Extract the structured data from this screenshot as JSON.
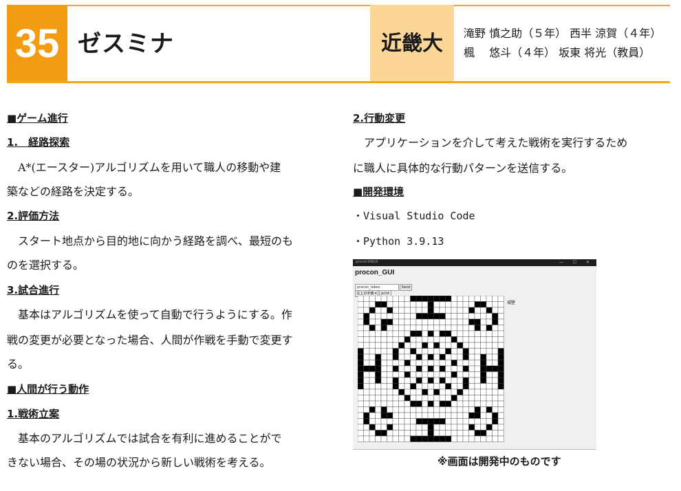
{
  "header": {
    "number": "35",
    "team_name": "ゼスミナ",
    "school": "近畿大",
    "members_line1": "滝野 慎之助（５年） 西半 涼賀（４年）",
    "members_line2": "楓　 悠斗（４年） 坂東 将光（教員）",
    "accent_color": "#f39c12",
    "school_bg": "#fcd697"
  },
  "left": {
    "game_heading": "■ゲーム進行",
    "s1_heading": "1.　経路探索",
    "s1_line1": "　A*(エースター)アルゴリズムを用いて職人の移動や建",
    "s1_line2": "築などの経路を決定する。",
    "s2_heading": "2.評価方法",
    "s2_line1": "　スタート地点から目的地に向かう経路を調べ、最短のも",
    "s2_line2": "のを選択する。",
    "s3_heading": "3.試合進行",
    "s3_line1": "　基本はアルゴリズムを使って自動で行うようにする。作",
    "s3_line2": "戦の変更が必要となった場合、人間が作戦を手動で変更す",
    "s3_line3": "る。",
    "human_heading": "■人間が行う動作",
    "h1_heading": "1.戦術立案",
    "h1_line1": "　基本のアルゴリズムでは試合を有利に進めることがで",
    "h1_line2": "きない場合、その場の状況から新しい戦術を考える。"
  },
  "right": {
    "h2_heading": "2.行動変更",
    "h2_line1": "　アプリケーションを介して考えた戦術を実行するため",
    "h2_line2": "に職人に具体的な行動パターンを送信する。",
    "env_heading": "■開発環境",
    "env_items": [
      "・Visual Studio Code",
      "・Python 3.9.13"
    ],
    "caption": "※画面は開発中のものです"
  },
  "screenshot": {
    "window_title": "procon34GUI",
    "app_title": "procon_GUI",
    "input_value": "procon_token",
    "button1": "Send",
    "button2": "print",
    "dropdown": "左上の手番 ▾",
    "side_label": "城壁",
    "grid_size": 25
  }
}
